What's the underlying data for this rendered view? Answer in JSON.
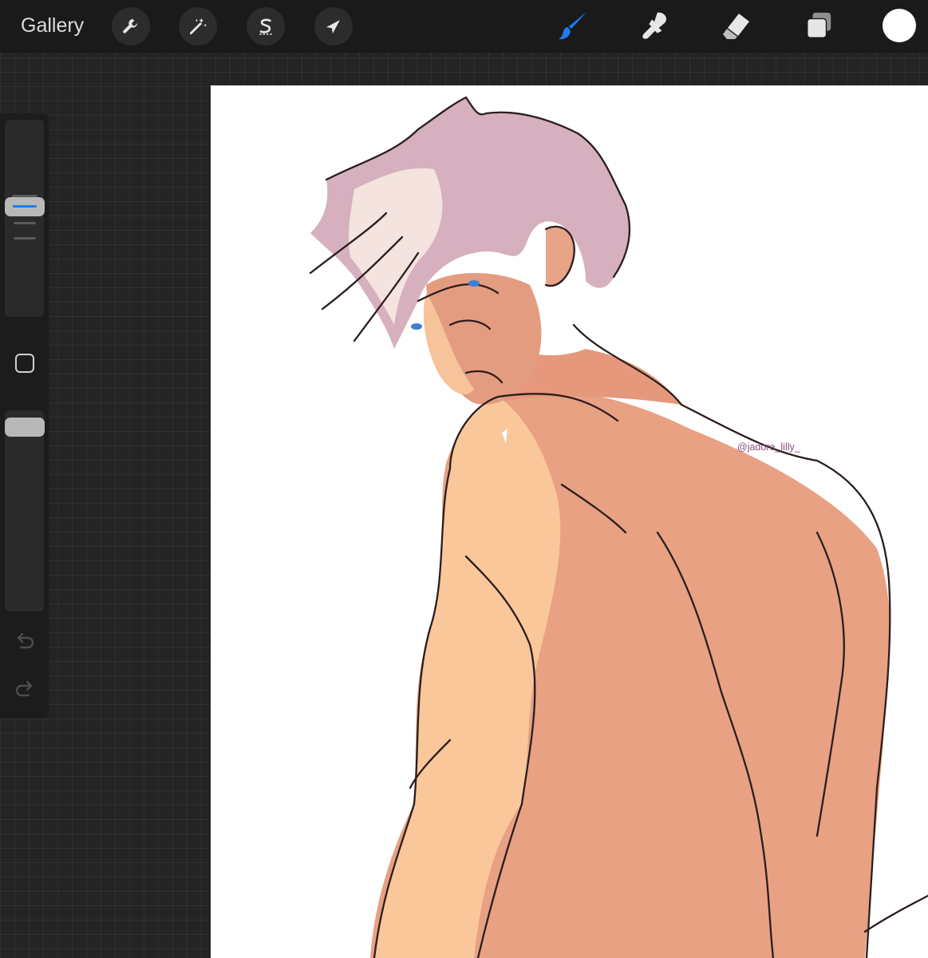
{
  "toolbar": {
    "gallery_label": "Gallery",
    "left_tools": [
      {
        "name": "actions",
        "icon": "wrench-icon"
      },
      {
        "name": "adjustments",
        "icon": "magic-wand-icon"
      },
      {
        "name": "selection",
        "icon": "selection-s-icon"
      },
      {
        "name": "transform",
        "icon": "arrow-cursor-icon"
      }
    ],
    "right_tools": [
      {
        "name": "brush",
        "icon": "brush-icon",
        "active": true
      },
      {
        "name": "smudge",
        "icon": "smudge-icon",
        "active": false
      },
      {
        "name": "eraser",
        "icon": "eraser-icon",
        "active": false
      },
      {
        "name": "layers",
        "icon": "layers-icon",
        "active": false
      }
    ],
    "current_color": "#ffffff",
    "active_color": "#1e7cf0"
  },
  "sidebar": {
    "brush_size_level": 0.52,
    "opacity_level": 0.96,
    "icons": [
      "square-modify-icon",
      "undo-icon",
      "redo-icon"
    ]
  },
  "canvas": {
    "watermark": "@jadore_lilly_"
  }
}
